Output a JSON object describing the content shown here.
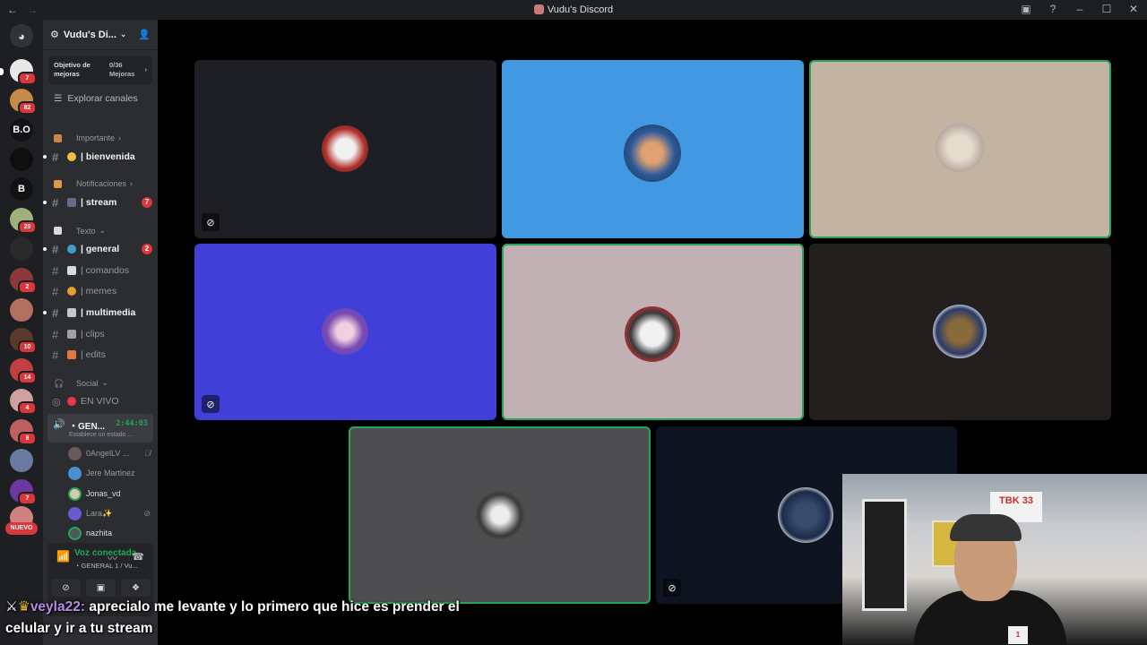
{
  "window": {
    "title": "Vudu's Discord"
  },
  "server": {
    "name": "Vudu's Di...",
    "boost_label": "Objetivo de mejoras",
    "boost_count": "0/36",
    "boost_unit": "Mejoras",
    "explore": "Explorar canales"
  },
  "categories": {
    "importante": "Importante",
    "notificaciones": "Notificaciones",
    "texto": "Texto",
    "social": "Social"
  },
  "channels": [
    {
      "name": "| bienvenida",
      "unread": true
    },
    {
      "name": "| stream",
      "unread": true,
      "count": "7"
    },
    {
      "name": "| general",
      "unread": true,
      "count": "2"
    },
    {
      "name": "| comandos",
      "unread": false
    },
    {
      "name": "| memes",
      "unread": false
    },
    {
      "name": "| multimedia",
      "unread": true
    },
    {
      "name": "| clips",
      "unread": false
    },
    {
      "name": "| edits",
      "unread": false
    },
    {
      "name": "EN VIVO",
      "unread": false
    }
  ],
  "voice_channel": {
    "name": "・GEN...",
    "timer": "2:44:03",
    "status": "Establece un estado ..."
  },
  "voice_users": [
    {
      "name": "0AngelLV ...",
      "icon": "mic-muted-icon"
    },
    {
      "name": "Jere Martinez",
      "icon": ""
    },
    {
      "name": "Jonas_vd",
      "icon": ""
    },
    {
      "name": "Lara✨",
      "icon": "camera-off-icon"
    },
    {
      "name": "nazhita",
      "icon": ""
    }
  ],
  "rail_badges": [
    "7",
    "82",
    "29",
    "2",
    "10",
    "14",
    "4",
    "9",
    "7"
  ],
  "rail_letters": [
    "B.O",
    "B"
  ],
  "rail_new": "NUEVO",
  "voice_panel": {
    "status": "Voz conectada",
    "channel": "・GENERAL 1 / Vu..."
  },
  "chat_overlay": {
    "user": "veyla22:",
    "message": "aprecialo me levante y lo primero que hice es prender el celular y ir a tu stream"
  },
  "webcam": {
    "sign_text": "TBK 33",
    "shirt_text": "1"
  },
  "colors": {
    "speaking": "#23a55a",
    "badge": "#da373c",
    "tile_blue": "#4299e1",
    "tile_indigo": "#4040d8"
  }
}
